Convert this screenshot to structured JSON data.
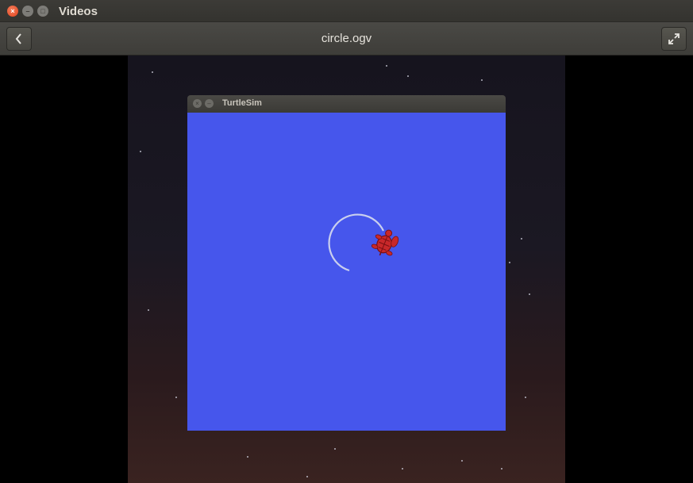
{
  "app": {
    "title": "Videos"
  },
  "window_controls": {
    "close": "×",
    "minimize": "–",
    "maximize": "□"
  },
  "header": {
    "file_title": "circle.ogv",
    "back_icon": "chevron-left-icon",
    "fullscreen_icon": "fullscreen-icon"
  },
  "turtlesim": {
    "title": "TurtleSim",
    "background_color": "#4656ec",
    "path_color": "#c9cfee",
    "turtle_color": "#c8282a"
  }
}
